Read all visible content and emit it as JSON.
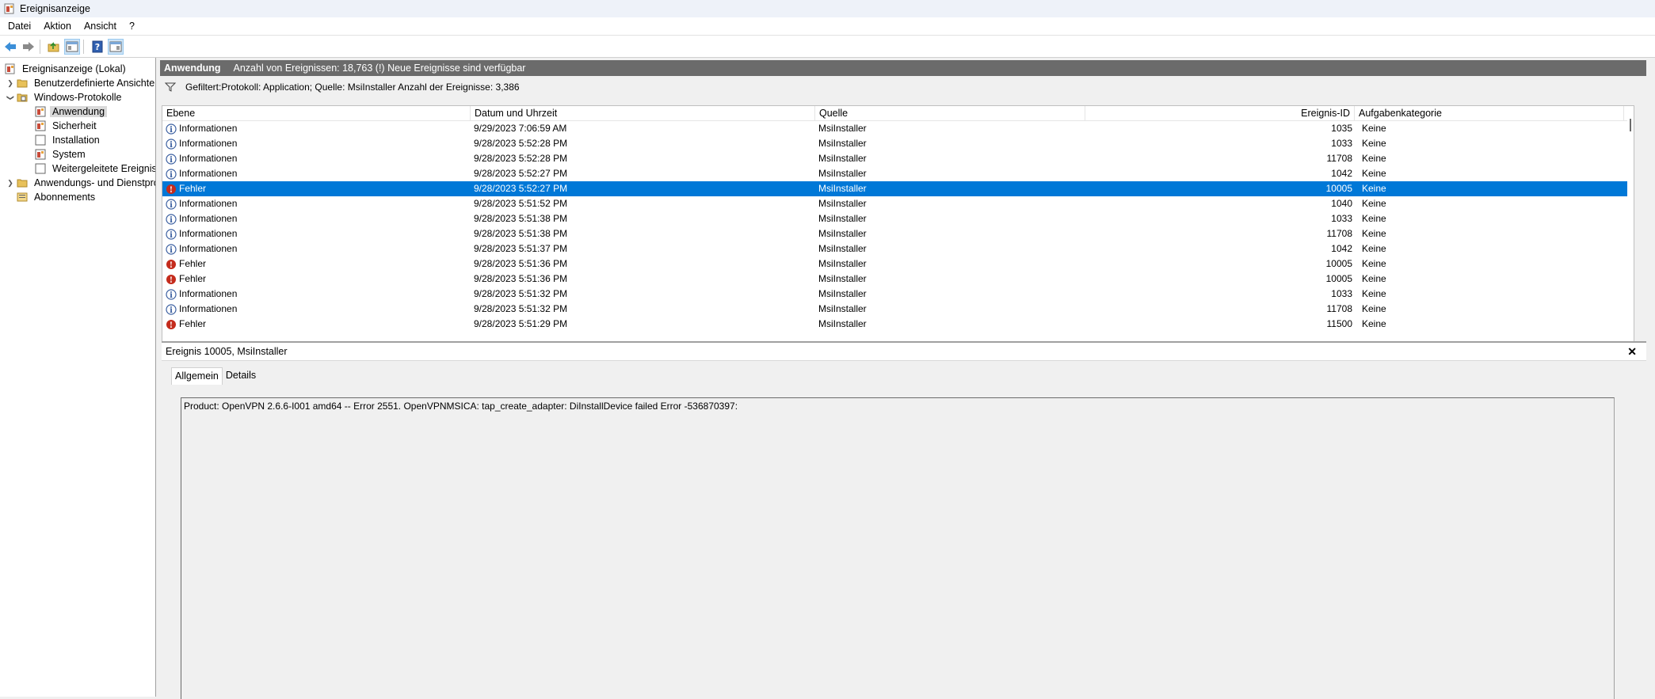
{
  "window": {
    "title": "Ereignisanzeige"
  },
  "menu": [
    "Datei",
    "Aktion",
    "Ansicht",
    "?"
  ],
  "toolbar": [
    "back-icon",
    "forward-icon",
    "folder-up-icon",
    "show-hide-tree-icon",
    "help-icon",
    "show-hide-action-pane-icon"
  ],
  "tree": {
    "root": "Ereignisanzeige (Lokal)",
    "custom_views": "Benutzerdefinierte Ansichten",
    "windows_logs": "Windows-Protokolle",
    "logs": [
      "Anwendung",
      "Sicherheit",
      "Installation",
      "System",
      "Weitergeleitete Ereignisse"
    ],
    "app_service_logs": "Anwendungs- und Dienstprotokolle",
    "subscriptions": "Abonnements"
  },
  "header": {
    "title": "Anwendung",
    "info": "Anzahl von Ereignissen: 18,763 (!) Neue Ereignisse sind verfügbar"
  },
  "filter": {
    "text": "Gefiltert:Protokoll: Application; Quelle: MsiInstaller Anzahl der Ereignisse: 3,386"
  },
  "columns": {
    "level": "Ebene",
    "date": "Datum und Uhrzeit",
    "source": "Quelle",
    "event_id": "Ereignis-ID",
    "category": "Aufgabenkategorie"
  },
  "events": [
    {
      "level": "Informationen",
      "type": "info",
      "date": "9/29/2023 7:06:59 AM",
      "source": "MsiInstaller",
      "event_id": "1035",
      "category": "Keine"
    },
    {
      "level": "Informationen",
      "type": "info",
      "date": "9/28/2023 5:52:28 PM",
      "source": "MsiInstaller",
      "event_id": "1033",
      "category": "Keine"
    },
    {
      "level": "Informationen",
      "type": "info",
      "date": "9/28/2023 5:52:28 PM",
      "source": "MsiInstaller",
      "event_id": "11708",
      "category": "Keine"
    },
    {
      "level": "Informationen",
      "type": "info",
      "date": "9/28/2023 5:52:27 PM",
      "source": "MsiInstaller",
      "event_id": "1042",
      "category": "Keine"
    },
    {
      "level": "Fehler",
      "type": "error",
      "date": "9/28/2023 5:52:27 PM",
      "source": "MsiInstaller",
      "event_id": "10005",
      "category": "Keine",
      "selected": true
    },
    {
      "level": "Informationen",
      "type": "info",
      "date": "9/28/2023 5:51:52 PM",
      "source": "MsiInstaller",
      "event_id": "1040",
      "category": "Keine"
    },
    {
      "level": "Informationen",
      "type": "info",
      "date": "9/28/2023 5:51:38 PM",
      "source": "MsiInstaller",
      "event_id": "1033",
      "category": "Keine"
    },
    {
      "level": "Informationen",
      "type": "info",
      "date": "9/28/2023 5:51:38 PM",
      "source": "MsiInstaller",
      "event_id": "11708",
      "category": "Keine"
    },
    {
      "level": "Informationen",
      "type": "info",
      "date": "9/28/2023 5:51:37 PM",
      "source": "MsiInstaller",
      "event_id": "1042",
      "category": "Keine"
    },
    {
      "level": "Fehler",
      "type": "error",
      "date": "9/28/2023 5:51:36 PM",
      "source": "MsiInstaller",
      "event_id": "10005",
      "category": "Keine"
    },
    {
      "level": "Fehler",
      "type": "error",
      "date": "9/28/2023 5:51:36 PM",
      "source": "MsiInstaller",
      "event_id": "10005",
      "category": "Keine"
    },
    {
      "level": "Informationen",
      "type": "info",
      "date": "9/28/2023 5:51:32 PM",
      "source": "MsiInstaller",
      "event_id": "1033",
      "category": "Keine"
    },
    {
      "level": "Informationen",
      "type": "info",
      "date": "9/28/2023 5:51:32 PM",
      "source": "MsiInstaller",
      "event_id": "11708",
      "category": "Keine"
    },
    {
      "level": "Fehler",
      "type": "error",
      "date": "9/28/2023 5:51:29 PM",
      "source": "MsiInstaller",
      "event_id": "11500",
      "category": "Keine"
    }
  ],
  "detail": {
    "title": "Ereignis 10005, MsiInstaller",
    "tabs": [
      "Allgemein",
      "Details"
    ],
    "message": "Product: OpenVPN 2.6.6-I001 amd64 -- Error 2551. OpenVPNMSICA: tap_create_adapter: DiInstallDevice failed  Error -536870397:"
  },
  "colors": {
    "selection": "#0078d7",
    "header_bar": "#6b6b6b",
    "error": "#c42b1c",
    "info": "#3b5fa0"
  }
}
